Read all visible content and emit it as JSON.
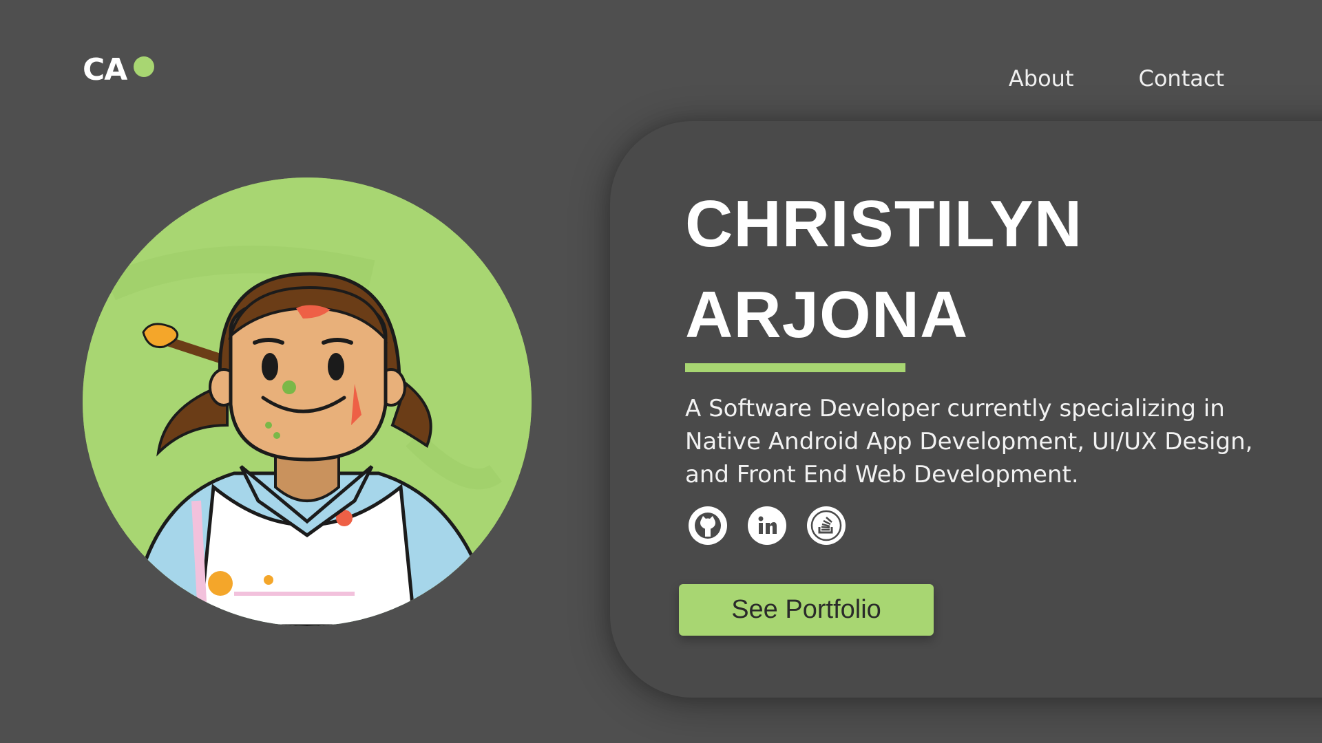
{
  "header": {
    "logo_text": "CA",
    "nav": [
      {
        "label": "About"
      },
      {
        "label": "Contact"
      }
    ]
  },
  "hero": {
    "name_line1": "CHRISTILYN",
    "name_line2": "ARJONA",
    "description": "A Software Developer currently specializing in Native Android App Development, UI/UX Design, and Front End Web Development.",
    "socials": [
      {
        "icon": "github-icon"
      },
      {
        "icon": "linkedin-icon"
      },
      {
        "icon": "stackoverflow-icon"
      }
    ],
    "cta_label": "See Portfolio"
  },
  "colors": {
    "background": "#4f4f4f",
    "card": "#4a4a4a",
    "accent": "#a8d672",
    "text": "#ffffff"
  }
}
